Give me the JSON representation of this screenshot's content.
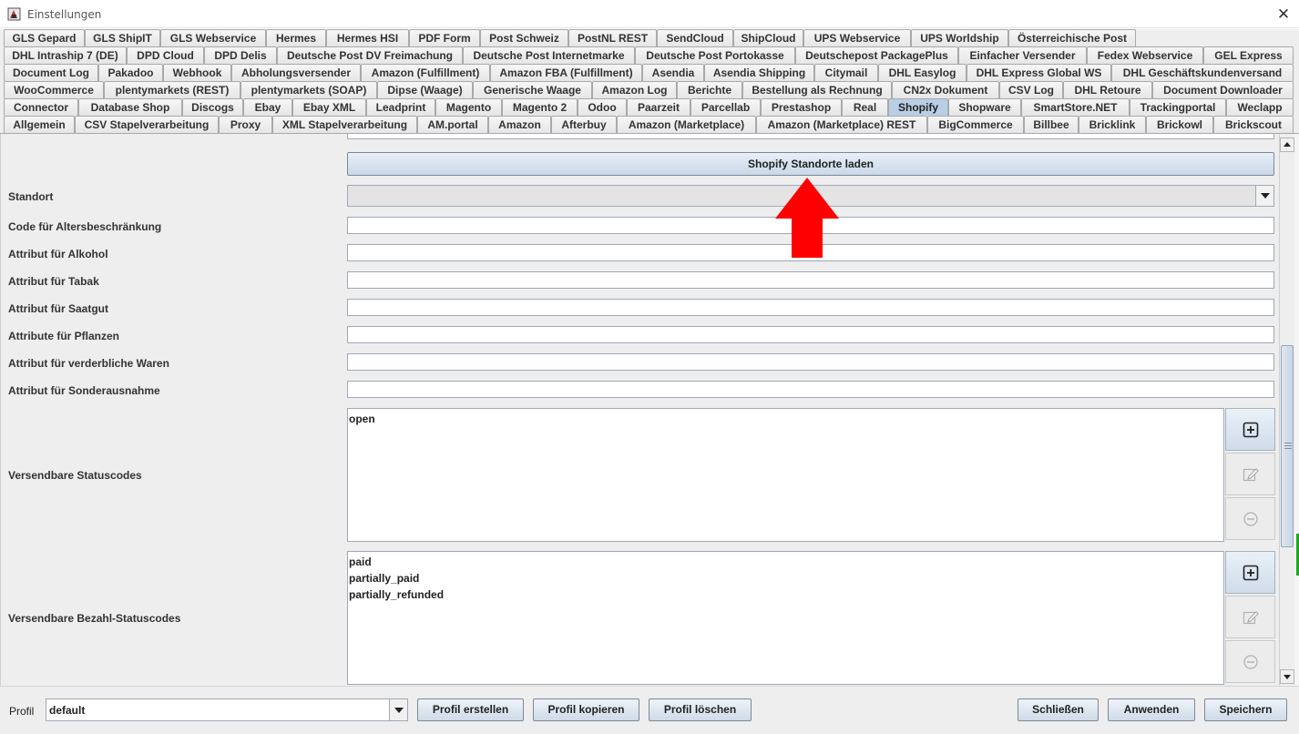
{
  "window": {
    "title": "Einstellungen",
    "close_symbol": "✕"
  },
  "tabs": {
    "rows": [
      [
        "GLS Gepard",
        "GLS ShipIT",
        "GLS Webservice",
        "Hermes",
        "Hermes HSI",
        "PDF Form",
        "Post Schweiz",
        "PostNL REST",
        "SendCloud",
        "ShipCloud",
        "UPS Webservice",
        "UPS Worldship",
        "Österreichische Post"
      ],
      [
        "DHL Intraship 7 (DE)",
        "DPD Cloud",
        "DPD Delis",
        "Deutsche Post DV Freimachung",
        "Deutsche Post Internetmarke",
        "Deutsche Post Portokasse",
        "Deutschepost PackagePlus",
        "Einfacher Versender",
        "Fedex Webservice",
        "GEL Express"
      ],
      [
        "Document Log",
        "Pakadoo",
        "Webhook",
        "Abholungsversender",
        "Amazon (Fulfillment)",
        "Amazon FBA (Fulfillment)",
        "Asendia",
        "Asendia Shipping",
        "Citymail",
        "DHL Easylog",
        "DHL Express Global WS",
        "DHL Geschäftskundenversand"
      ],
      [
        "WooCommerce",
        "plentymarkets (REST)",
        "plentymarkets (SOAP)",
        "Dipse (Waage)",
        "Generische Waage",
        "Amazon Log",
        "Berichte",
        "Bestellung als Rechnung",
        "CN2x Dokument",
        "CSV Log",
        "DHL Retoure",
        "Document Downloader"
      ],
      [
        "Connector",
        "Database Shop",
        "Discogs",
        "Ebay",
        "Ebay XML",
        "Leadprint",
        "Magento",
        "Magento 2",
        "Odoo",
        "Paarzeit",
        "Parcellab",
        "Prestashop",
        "Real",
        "Shopify",
        "Shopware",
        "SmartStore.NET",
        "Trackingportal",
        "Weclapp"
      ],
      [
        "Allgemein",
        "CSV Stapelverarbeitung",
        "Proxy",
        "XML Stapelverarbeitung",
        "AM.portal",
        "Amazon",
        "Afterbuy",
        "Amazon (Marketplace)",
        "Amazon (Marketplace) REST",
        "BigCommerce",
        "Billbee",
        "Bricklink",
        "Brickowl",
        "Brickscout"
      ]
    ],
    "active": "Shopify"
  },
  "form": {
    "load_locations_button": "Shopify Standorte laden",
    "standort_label": "Standort",
    "age_code_label": "Code für Altersbeschränkung",
    "alcohol_label": "Attribut für Alkohol",
    "tobacco_label": "Attribut für Tabak",
    "seed_label": "Attribut für Saatgut",
    "plants_label": "Attribute für Pflanzen",
    "perishable_label": "Attribut für verderbliche Waren",
    "exception_label": "Attribut für Sonderausnahme",
    "status_codes_label": "Versendbare Statuscodes",
    "status_codes": [
      "open"
    ],
    "payment_codes_label": "Versendbare Bezahl-Statuscodes",
    "payment_codes": [
      "paid",
      "partially_paid",
      "partially_refunded"
    ]
  },
  "footer": {
    "profil_label": "Profil",
    "profil_value": "default",
    "create_profile": "Profil erstellen",
    "copy_profile": "Profil kopieren",
    "delete_profile": "Profil löschen",
    "close": "Schließen",
    "apply": "Anwenden",
    "save": "Speichern"
  },
  "colors": {
    "active_tab": "#b8cfe5",
    "annotation_arrow": "#ff0000",
    "panel_background": "#eeeeee"
  },
  "icons": {
    "add": "plus-square-icon",
    "edit": "pencil-icon",
    "remove": "minus-circle-icon"
  }
}
